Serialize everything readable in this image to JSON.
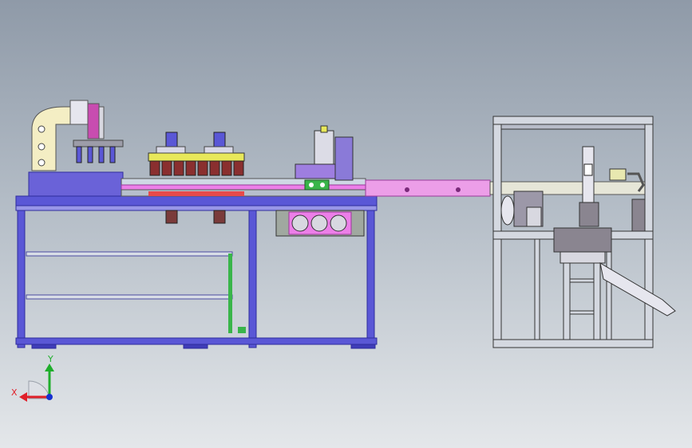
{
  "triad": {
    "x_label": "X",
    "y_label": "Y",
    "x_color": "#e0202a",
    "y_color": "#1fae2c",
    "z_color": "#1530d0"
  },
  "colors": {
    "frame": "#5a57d6",
    "frame_dark": "#2f2c9c",
    "magenta": "#ec7fe8",
    "yellow": "#e8e85a",
    "gray_machine": "#8a8590",
    "green": "#39b54a"
  }
}
